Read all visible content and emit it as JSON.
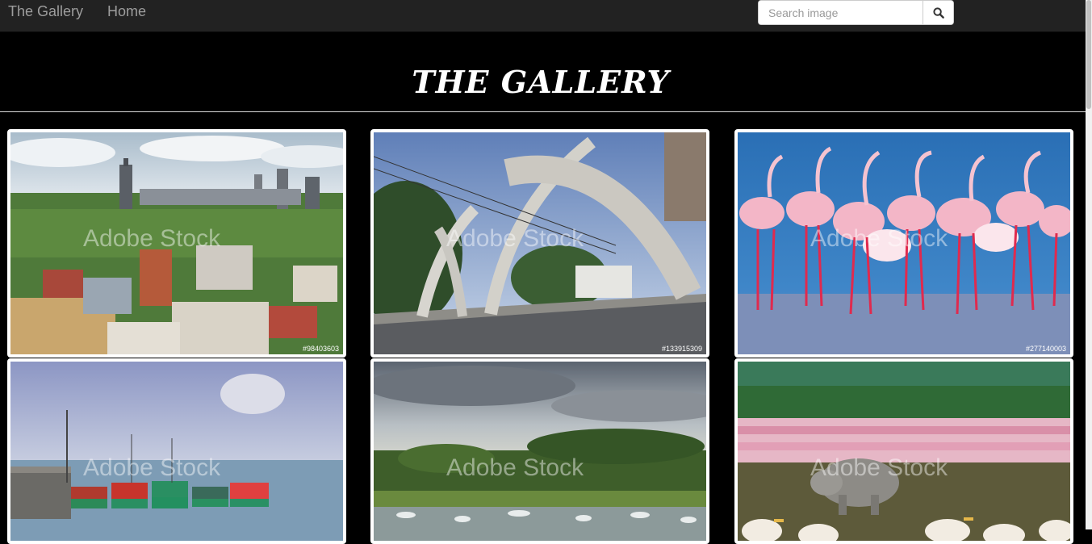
{
  "navbar": {
    "brand": "The Gallery",
    "home": "Home"
  },
  "search": {
    "placeholder": "Search image"
  },
  "header": {
    "title": "THE GALLERY"
  },
  "images": [
    {
      "id_text": "#98403603",
      "watermark": "Adobe Stock"
    },
    {
      "id_text": "#133915309",
      "watermark": "Adobe Stock"
    },
    {
      "id_text": "#277140003",
      "watermark": "Adobe Stock"
    },
    {
      "id_text": "",
      "watermark": "Adobe Stock"
    },
    {
      "id_text": "",
      "watermark": "Adobe Stock"
    },
    {
      "id_text": "",
      "watermark": "Adobe Stock"
    }
  ]
}
